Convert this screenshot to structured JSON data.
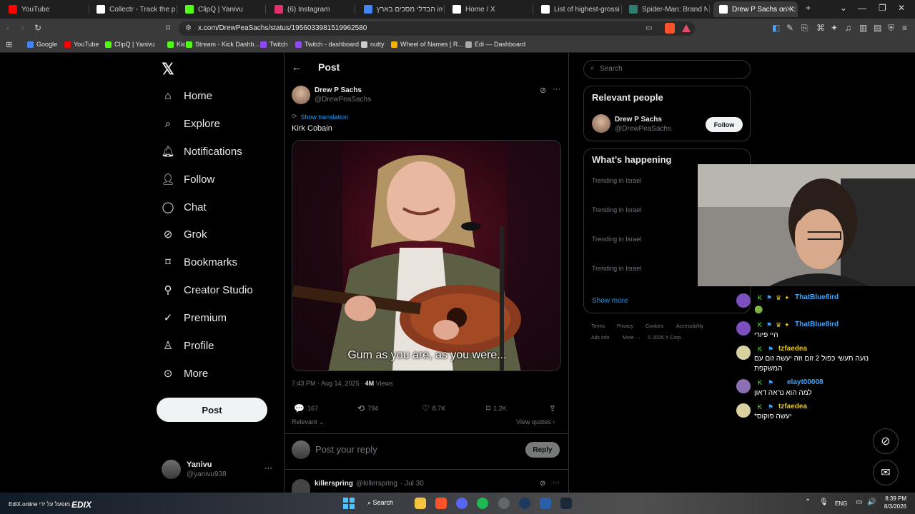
{
  "browser": {
    "tabs": [
      {
        "title": "YouTube",
        "color": "#ff0000"
      },
      {
        "title": "Collectr - Track the prices",
        "color": "#ffffff"
      },
      {
        "title": "ClipQ | Yanivu",
        "color": "#53fc18"
      },
      {
        "title": "(6) Instagram",
        "color": "#e1306c"
      },
      {
        "title": "הבדלי מסכים בארץ imax",
        "color": "#4285f4"
      },
      {
        "title": "Home / X",
        "color": "#ffffff"
      },
      {
        "title": "List of highest-grossing fi",
        "color": "#ffffff"
      },
      {
        "title": "Spider-Man: Brand New D",
        "color": "#2e7d6f"
      },
      {
        "title": "Drew P Sachs on X: \"",
        "color": "#ffffff"
      }
    ],
    "url": "x.com/DrewPeaSachs/status/1956033981519962580",
    "bookmarks": [
      {
        "label": "Google",
        "color": "#4285f4"
      },
      {
        "label": "YouTube",
        "color": "#ff0000"
      },
      {
        "label": "ClipQ | Yanivu",
        "color": "#53fc18"
      },
      {
        "label": "Kick",
        "color": "#53fc18"
      },
      {
        "label": "Stream - Kick Dashb...",
        "color": "#53fc18"
      },
      {
        "label": "Twitch",
        "color": "#9146ff"
      },
      {
        "label": "Twitch - dashboard",
        "color": "#9146ff"
      },
      {
        "label": "nutty",
        "color": "#cccccc"
      },
      {
        "label": "Wheel of Names | R...",
        "color": "#f4b400"
      },
      {
        "label": "Edi — Dashboard",
        "color": "#aaaaaa"
      }
    ]
  },
  "nav": {
    "items": [
      "Home",
      "Explore",
      "Notifications",
      "Follow",
      "Chat",
      "Grok",
      "Bookmarks",
      "Creator Studio",
      "Premium",
      "Profile",
      "More"
    ],
    "post_button": "Post",
    "account": {
      "name": "Yanivu",
      "handle": "@yanivu938"
    }
  },
  "post": {
    "header": "Post",
    "author_name": "Drew P Sachs",
    "author_handle": "@DrewPeaSachs",
    "show_translation": "Show translation",
    "text": "Kirk Cobain",
    "image_caption": "Gum as you are, as you were...",
    "timestamp": "7:43 PM · Aug 14, 2025 · ",
    "views_count": "4M",
    "views_label": "Views",
    "stats": {
      "replies": "167",
      "reposts": "794",
      "likes": "8.7K",
      "bookmarks": "1.2K"
    },
    "sort": "Relevant",
    "view_quotes": "View quotes",
    "reply_placeholder": "Post your reply",
    "reply_button": "Reply",
    "next_reply": {
      "name": "killerspring",
      "handle": "@killerspring",
      "date": "· Jul 30"
    }
  },
  "sidebar": {
    "search_placeholder": "Search",
    "relevant_title": "Relevant people",
    "person": {
      "name": "Drew P Sachs",
      "handle": "@DrewPeaSachs",
      "follow": "Follow"
    },
    "happening_title": "What’s happening",
    "trends": [
      "Trending in Israel",
      "Trending in Israel",
      "Trending in Israel",
      "Trending in Israel"
    ],
    "show_more": "Show more",
    "footer": [
      "Terms",
      "Privacy",
      "Cookies",
      "Accessibility",
      "Ads info",
      "More ···",
      "© 2026 X Corp."
    ]
  },
  "stream_chat": [
    {
      "user": "ThatBlue8ird",
      "text": "🟢",
      "color": "#3ea6ff"
    },
    {
      "user": "ThatBlue8ird",
      "text": "היי פיורי",
      "color": "#3ea6ff"
    },
    {
      "user": "tzfaedea",
      "text": "נועה תעשי כפול 2 זום וזה יעשה זום עם המשקפת",
      "color": "#e5c71a"
    },
    {
      "user": "elayt00008",
      "text": "למה הוא נראה דאון",
      "color": "#3ea6ff"
    },
    {
      "user": "tzfaedea",
      "text": "יעשה פוקוס*",
      "color": "#e5c71a"
    }
  ],
  "taskbar": {
    "overlay_text": "EdiX.online מופעל על ידי",
    "overlay_logo": "EDIX",
    "search": "Search",
    "lang": "ENG",
    "time": "8:39 PM",
    "date": "8/3/2026"
  }
}
